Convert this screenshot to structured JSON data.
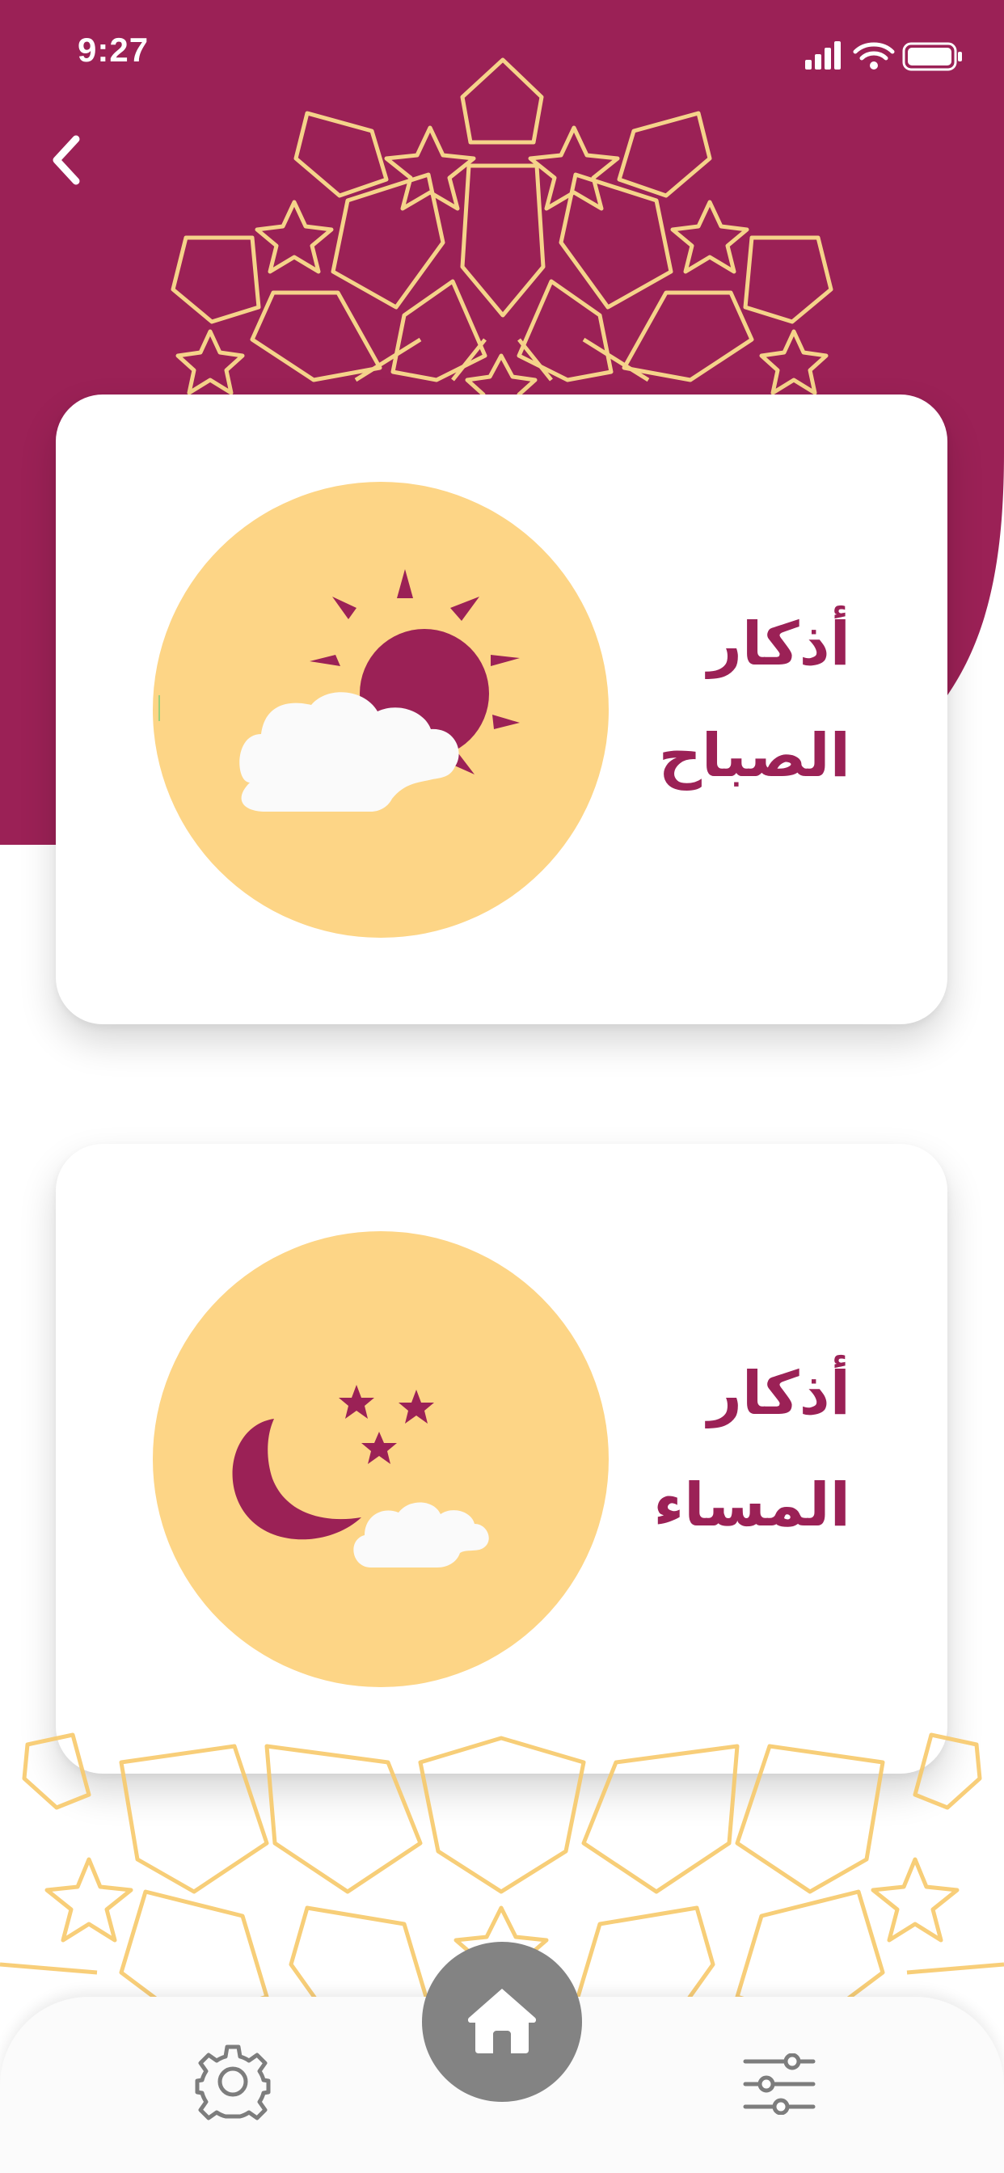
{
  "status_bar": {
    "time": "9:27"
  },
  "header": {
    "back_icon": "chevron-left-icon"
  },
  "cards": [
    {
      "id": "morning",
      "line1": "أذكار",
      "line2": "الصباح",
      "icon": "sun-cloud-icon"
    },
    {
      "id": "evening",
      "line1": "أذكار",
      "line2": "المساء",
      "icon": "moon-stars-cloud-icon"
    }
  ],
  "bottom_nav": {
    "left_icon": "gear-icon",
    "center_icon": "home-icon",
    "right_icon": "sliders-icon"
  },
  "colors": {
    "primary": "#9b2156",
    "accent": "#fdd586",
    "pattern": "#f7c96a",
    "nav_gray": "#838383"
  }
}
